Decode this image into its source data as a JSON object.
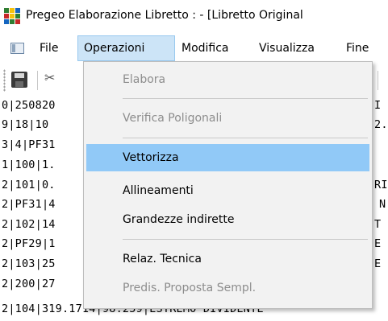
{
  "window": {
    "title": "Pregeo Elaborazione Libretto : - [Libretto Original"
  },
  "menubar": {
    "items": [
      {
        "label": "File"
      },
      {
        "label": "Operazioni",
        "active": true
      },
      {
        "label": "Modifica"
      },
      {
        "label": "Visualizza"
      },
      {
        "label": "Fine"
      }
    ]
  },
  "toolbar": {
    "cut_glyph": "✂"
  },
  "text_lines": [
    "0|250820",
    "9|18|10",
    "3|4|PF31",
    "1|100|1.",
    "2|101|0.",
    "2|PF31|4",
    "2|102|14",
    "2|PF29|1",
    "2|103|25",
    "2|200|27",
    "2|104|319.1714|98.259|ESTREMO DIVIDENTE"
  ],
  "text_right_fragments": [
    {
      "row": 0,
      "text": "I"
    },
    {
      "row": 1,
      "text": "2."
    },
    {
      "row": 4,
      "text": "RI"
    },
    {
      "row": 5,
      "text": "N"
    },
    {
      "row": 6,
      "text": "T"
    },
    {
      "row": 7,
      "text": "E"
    },
    {
      "row": 8,
      "text": "E"
    }
  ],
  "dropdown": {
    "items": [
      {
        "label": "Elabora",
        "disabled": true
      },
      {
        "label": "Verifica Poligonali",
        "disabled": true
      },
      {
        "label": "Vettorizza",
        "highlighted": true
      },
      {
        "label": "Allineamenti"
      },
      {
        "label": "Grandezze indirette"
      },
      {
        "label": "Relaz. Tecnica"
      },
      {
        "label": "Predis. Proposta Sempl.",
        "disabled": true
      }
    ]
  },
  "colors": {
    "menu_active_bg": "#cce4f7",
    "dropdown_highlight": "#91c9f7",
    "disabled_text": "#8d8d8d"
  }
}
